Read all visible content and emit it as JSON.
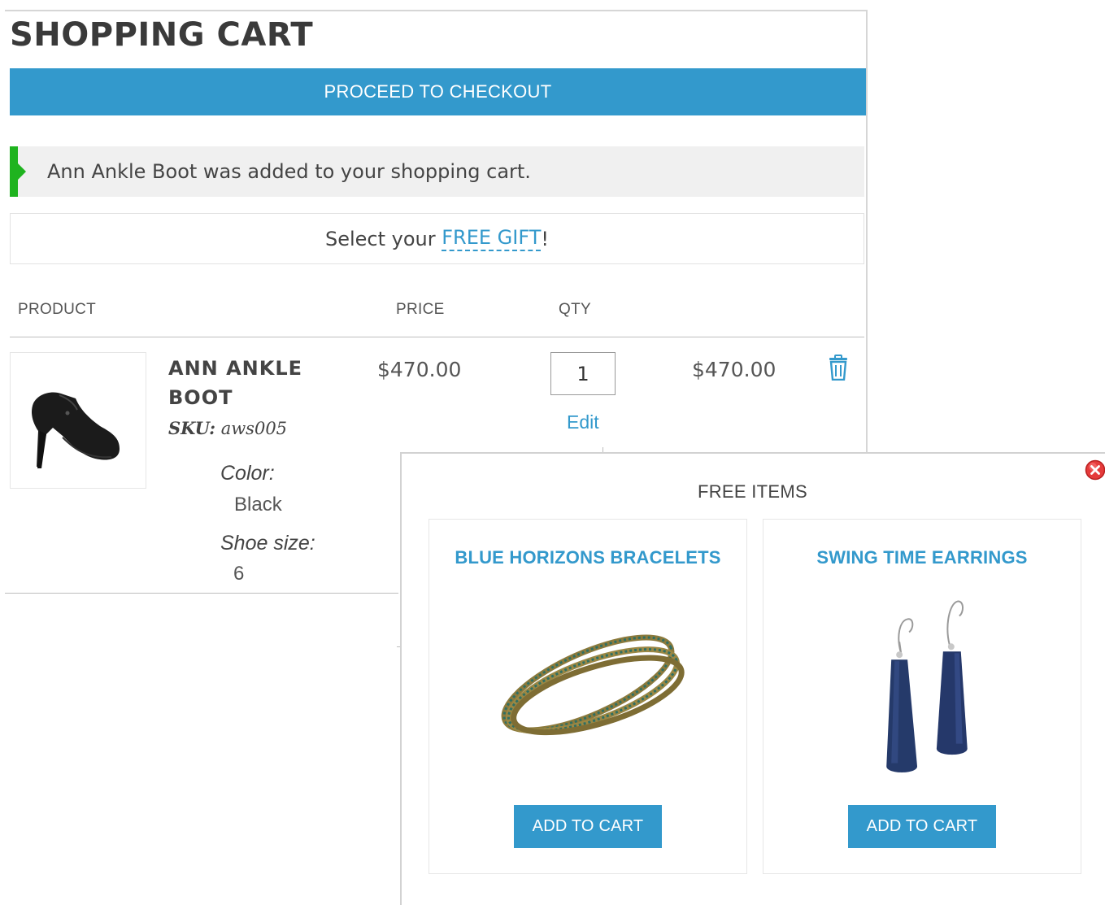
{
  "header": {
    "title": "SHOPPING CART",
    "checkout_label": "PROCEED TO CHECKOUT"
  },
  "message": {
    "text": "Ann Ankle Boot was added to your shopping cart.",
    "accent_color": "#1fb31f"
  },
  "gift_promo": {
    "prefix": "Select your ",
    "link_text": "FREE GIFT",
    "suffix": "!"
  },
  "table": {
    "columns": [
      "PRODUCT",
      "PRICE",
      "QTY"
    ],
    "rows": [
      {
        "name": "ANN ANKLE BOOT",
        "sku_label": "SKU:",
        "sku": "aws005",
        "options": [
          {
            "label": "Color:",
            "value": "Black"
          },
          {
            "label": "Shoe size:",
            "value": "6"
          }
        ],
        "price": "$470.00",
        "qty": "1",
        "edit_label": "Edit",
        "subtotal": "$470.00",
        "delete_icon": "trash-icon",
        "image_icon": "ankle-boot-image"
      }
    ]
  },
  "popup": {
    "title": "FREE ITEMS",
    "close_icon": "close-icon",
    "items": [
      {
        "name": "BLUE HORIZONS BRACELETS",
        "button_label": "ADD TO CART",
        "image_icon": "bracelets-image"
      },
      {
        "name": "SWING TIME EARRINGS",
        "button_label": "ADD TO CART",
        "image_icon": "earrings-image"
      }
    ]
  },
  "colors": {
    "brand": "#3399cc",
    "success": "#1fb31f",
    "text": "#444444"
  }
}
